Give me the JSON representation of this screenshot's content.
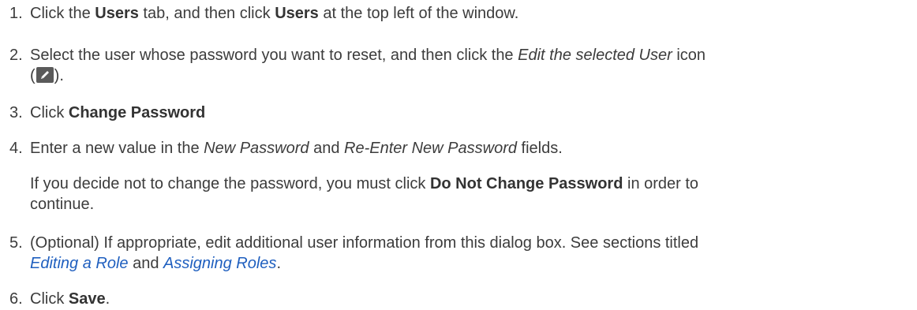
{
  "steps": [
    {
      "num": "1.",
      "t1": "Click the ",
      "b1": "Users",
      "t2": " tab, and then click ",
      "b2": "Users",
      "t3": " at the top left of the window."
    },
    {
      "num": "2.",
      "t1": "Select the user whose password you want to reset, and then click the ",
      "i1": "Edit the selected User",
      "t2": " icon",
      "open": "(",
      "close": ").",
      "icon": "pencil-icon"
    },
    {
      "num": "3.",
      "t1": "Click ",
      "b1": "Change Password"
    },
    {
      "num": "4.",
      "t1": "Enter a new value in the ",
      "i1": "New Password",
      "t2": " and ",
      "i2": "Re-Enter New Password",
      "t3": " fields."
    },
    {
      "num": "5.",
      "t1": "(Optional) If appropriate, edit additional user information from this dialog box. See sections titled",
      "link1": "Editing a Role",
      "t2": " and ",
      "link2": "Assigning Roles",
      "t3": "."
    },
    {
      "num": "6.",
      "t1": "Click ",
      "b1": "Save",
      "t2": "."
    }
  ],
  "note": {
    "t1": "If you decide not to change the password, you must click ",
    "b1": "Do Not Change Password",
    "t2": " in order to",
    "t3": "continue."
  },
  "colors": {
    "text": "#3c3c3c",
    "link": "#1f5fbf",
    "icon_bg": "#5a5a5a"
  }
}
